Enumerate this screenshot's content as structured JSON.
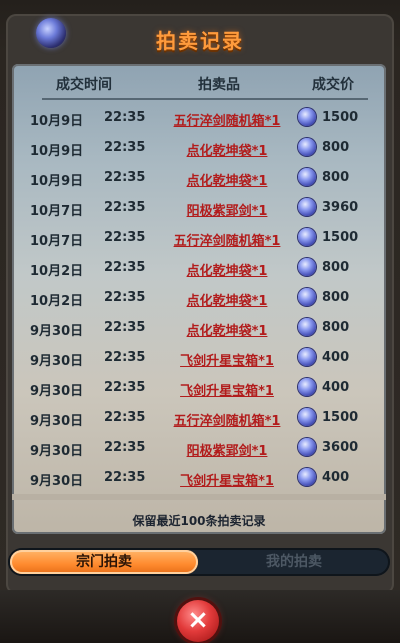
{
  "title": "拍卖记录",
  "header": {
    "col_time": "成交时间",
    "col_item": "拍卖品",
    "col_price": "成交价"
  },
  "rows": [
    {
      "date": "10月9日",
      "time": "22:35",
      "item": "五行淬剑随机箱*1",
      "price": "1500"
    },
    {
      "date": "10月9日",
      "time": "22:35",
      "item": "点化乾坤袋*1",
      "price": "800"
    },
    {
      "date": "10月9日",
      "time": "22:35",
      "item": "点化乾坤袋*1",
      "price": "800"
    },
    {
      "date": "10月7日",
      "time": "22:35",
      "item": "阳极紫郢剑*1",
      "price": "3960"
    },
    {
      "date": "10月7日",
      "time": "22:35",
      "item": "五行淬剑随机箱*1",
      "price": "1500"
    },
    {
      "date": "10月2日",
      "time": "22:35",
      "item": "点化乾坤袋*1",
      "price": "800"
    },
    {
      "date": "10月2日",
      "time": "22:35",
      "item": "点化乾坤袋*1",
      "price": "800"
    },
    {
      "date": "9月30日",
      "time": "22:35",
      "item": "点化乾坤袋*1",
      "price": "800"
    },
    {
      "date": "9月30日",
      "time": "22:35",
      "item": "飞剑升星宝箱*1",
      "price": "400"
    },
    {
      "date": "9月30日",
      "time": "22:35",
      "item": "飞剑升星宝箱*1",
      "price": "400"
    },
    {
      "date": "9月30日",
      "time": "22:35",
      "item": "五行淬剑随机箱*1",
      "price": "1500"
    },
    {
      "date": "9月30日",
      "time": "22:35",
      "item": "阳极紫郢剑*1",
      "price": "3600"
    },
    {
      "date": "9月30日",
      "time": "22:35",
      "item": "飞剑升星宝箱*1",
      "price": "400"
    }
  ],
  "note": "保留最近100条拍卖记录",
  "tabs": {
    "sect": "宗门拍卖",
    "mine": "我的拍卖"
  },
  "close_icon": "×",
  "colors": {
    "title": "#ff9b3c",
    "item_link": "#b21c1c",
    "active_tab": "#ff8a2e"
  }
}
